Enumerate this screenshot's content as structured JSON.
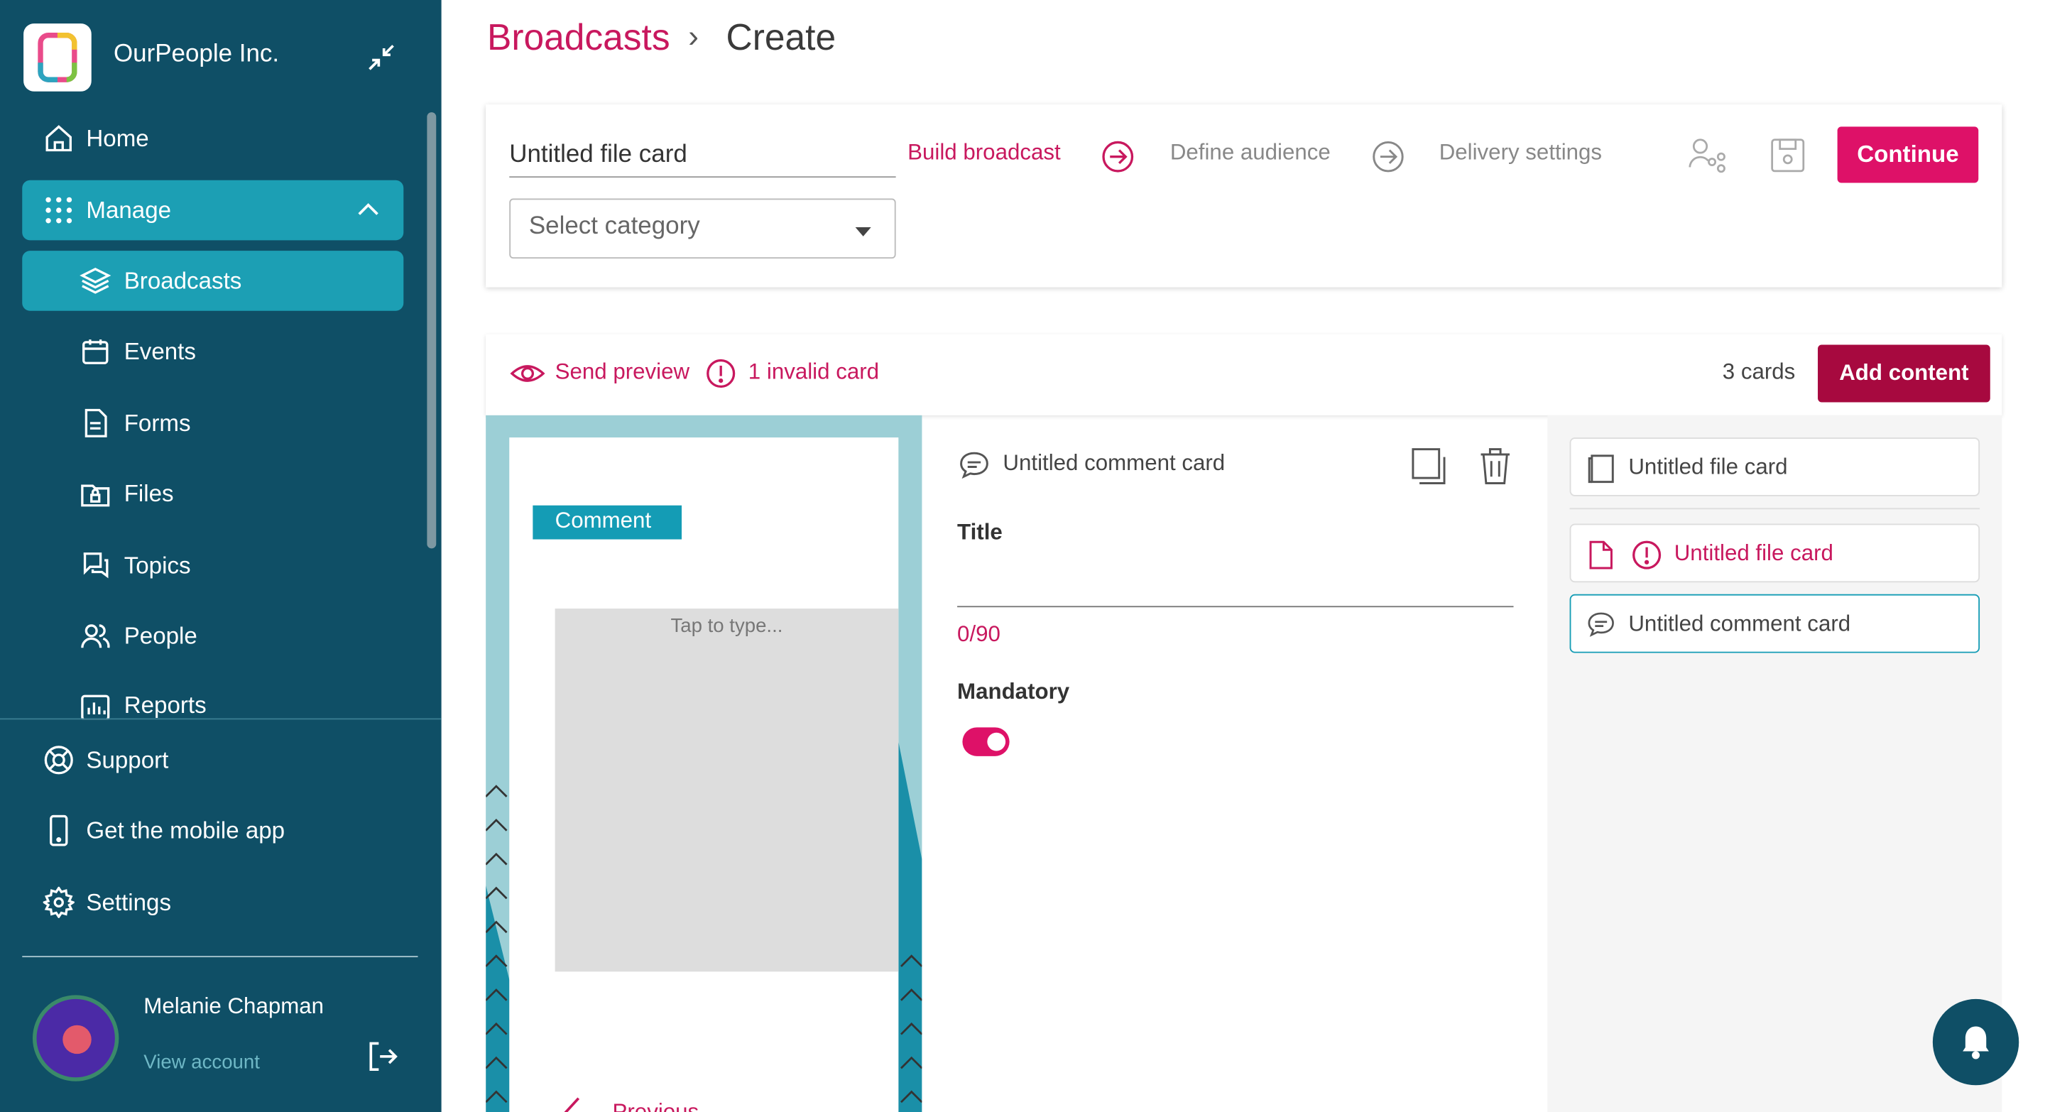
{
  "sidebar": {
    "org_name": "OurPeople Inc.",
    "nav": {
      "home": "Home",
      "manage": "Manage",
      "broadcasts": "Broadcasts",
      "events": "Events",
      "forms": "Forms",
      "files": "Files",
      "topics": "Topics",
      "people": "People",
      "reports": "Reports",
      "support": "Support",
      "mobile_app": "Get the mobile app",
      "settings": "Settings"
    },
    "user": {
      "name": "Melanie Chapman",
      "link": "View account"
    }
  },
  "header": {
    "breadcrumb_parent": "Broadcasts",
    "separator": "›",
    "breadcrumb_current": "Create"
  },
  "builder": {
    "title_value": "Untitled file card",
    "category_placeholder": "Select category",
    "steps": [
      "Build broadcast",
      "Define audience",
      "Delivery settings"
    ],
    "continue_label": "Continue"
  },
  "toolbar": {
    "send_preview": "Send preview",
    "invalid": "1 invalid card",
    "cards_count": "3 cards",
    "add_content": "Add content"
  },
  "preview": {
    "tag": "Comment",
    "placeholder": "Tap to type...",
    "previous": "Previous"
  },
  "editor": {
    "card_title": "Untitled comment card",
    "title_label": "Title",
    "counter": "0/90",
    "mandatory_label": "Mandatory",
    "mandatory_on": true
  },
  "cards": [
    {
      "label": "Untitled file card",
      "icon": "file-card-icon",
      "state": "normal"
    },
    {
      "label": "Untitled file card",
      "icon": "document-icon",
      "state": "invalid"
    },
    {
      "label": "Untitled comment card",
      "icon": "comment-icon",
      "state": "selected"
    }
  ],
  "colors": {
    "sidebar": "#0f4f66",
    "active": "#1c9fb4",
    "brand": "#de1168",
    "accent_dark": "#a7093f"
  }
}
